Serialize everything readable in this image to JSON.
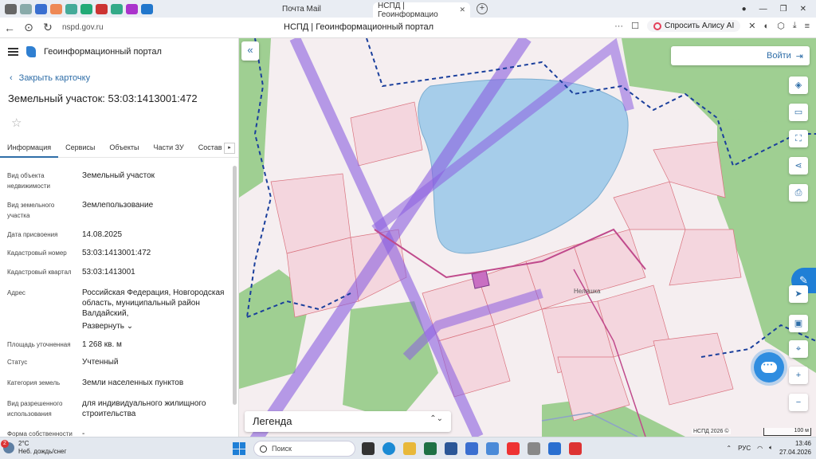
{
  "browser": {
    "tabs": [
      {
        "label": "Почта Mail"
      },
      {
        "label": "НСПД | Геоинформацио"
      }
    ],
    "url": "nspd.gov.ru",
    "page_title": "НСПД | Геоинформационный портал",
    "alice_label": "Спросить Алису AI"
  },
  "panel": {
    "portal_name": "Геоинформационный портал",
    "back_label": "Закрыть карточку",
    "title": "Земельный участок: 53:03:1413001:472",
    "tabs": [
      "Информация",
      "Сервисы",
      "Объекты",
      "Части ЗУ",
      "Состав"
    ],
    "rows": [
      {
        "key": "Вид объекта недвижимости",
        "value": "Земельный участок"
      },
      {
        "key": "Вид земельного участка",
        "value": "Землепользование"
      },
      {
        "key": "Дата присвоения",
        "value": "14.08.2025"
      },
      {
        "key": "Кадастровый номер",
        "value": "53:03:1413001:472"
      },
      {
        "key": "Кадастровый квартал",
        "value": "53:03:1413001"
      },
      {
        "key": "Адрес",
        "value": "Российская Федерация, Новгородская область, муниципальный район Валдайский,"
      },
      {
        "key": "Площадь уточненная",
        "value": "1 268 кв. м"
      },
      {
        "key": "Статус",
        "value": "Учтенный"
      },
      {
        "key": "Категория земель",
        "value": "Земли населенных пунктов"
      },
      {
        "key": "Вид разрешенного использования",
        "value": "для индивидуального жилищного строительства"
      },
      {
        "key": "Форма собственности",
        "value": "-"
      }
    ],
    "expand_label": "Развернуть"
  },
  "map": {
    "login_label": "Войти",
    "legend_label": "Легенда",
    "place_label": "Неляшка",
    "attribution": "НСПД 2026 ©",
    "scale_label": "100 м",
    "colors": {
      "water": "#a6cdea",
      "forest": "#9fcf92",
      "parcel": "#f4d6de",
      "zone_border": "#1a3f9c",
      "corridor": "#8a5fe0"
    }
  },
  "taskbar": {
    "temp": "2°C",
    "weather": "Неб. дождь/снег",
    "badge": "2",
    "search_placeholder": "Поиск",
    "lang": "РУС",
    "time": "13:46",
    "date": "27.04.2026"
  }
}
